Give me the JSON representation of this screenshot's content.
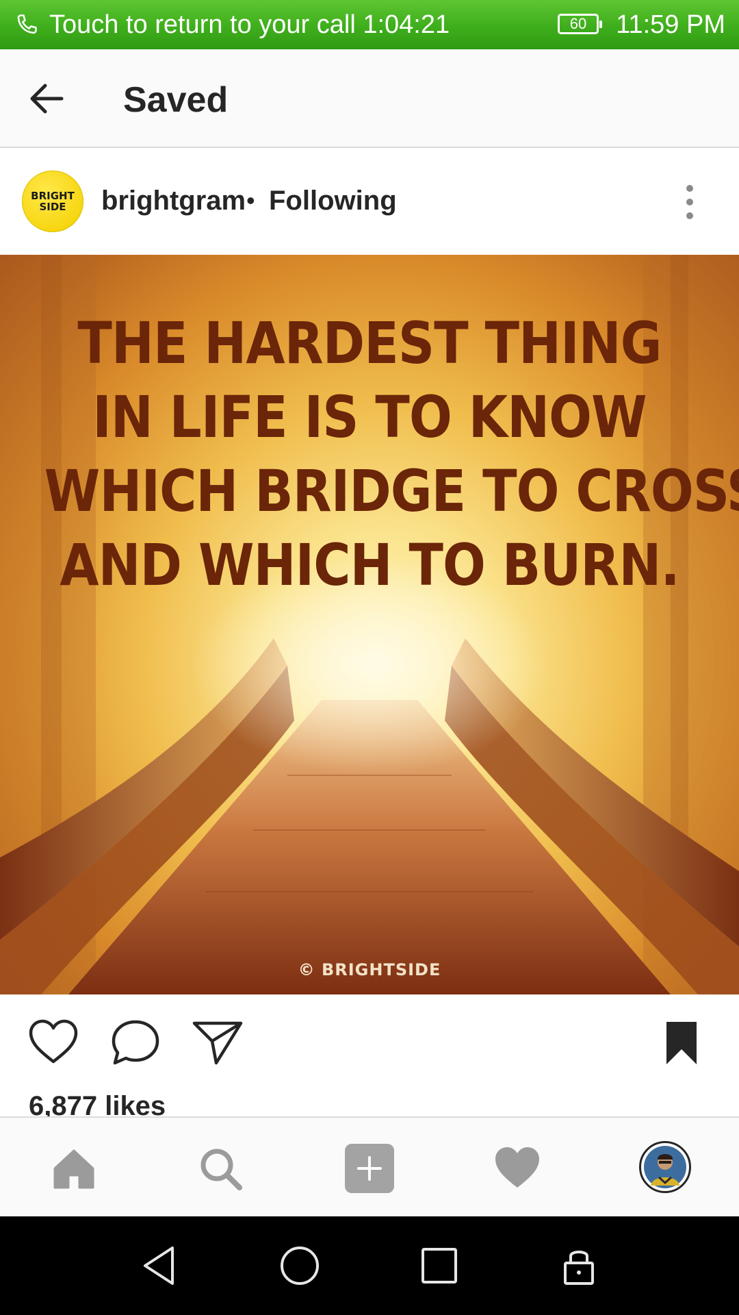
{
  "status_bar": {
    "call_text": "Touch to return to your call 1:04:21",
    "battery": "60",
    "time": "11:59 PM",
    "background_color": "#3fae1c"
  },
  "app_bar": {
    "back_icon": "arrow-left-icon",
    "title": "Saved"
  },
  "post": {
    "avatar_text": "BRIGHT\nSIDE",
    "username": "brightgram",
    "separator": "•",
    "follow_status": "Following",
    "menu_icon": "more-vertical-icon",
    "image": {
      "quote_lines": [
        "THE HARDEST THING",
        "IN LIFE IS TO KNOW",
        "WHICH BRIDGE TO CROSS",
        "AND WHICH TO BURN."
      ],
      "watermark": "© BRIGHTSIDE"
    },
    "actions": {
      "like_icon": "heart-outline-icon",
      "comment_icon": "comment-bubble-icon",
      "share_icon": "paper-plane-icon",
      "save_icon": "bookmark-filled-icon"
    },
    "likes_text": "6,877 likes"
  },
  "bottom_nav": {
    "items": [
      "home-icon",
      "search-icon",
      "add-post-icon",
      "activity-heart-icon",
      "profile-avatar"
    ]
  },
  "system_nav": {
    "items": [
      "back-triangle-icon",
      "home-circle-icon",
      "recents-square-icon",
      "lock-icon"
    ]
  }
}
